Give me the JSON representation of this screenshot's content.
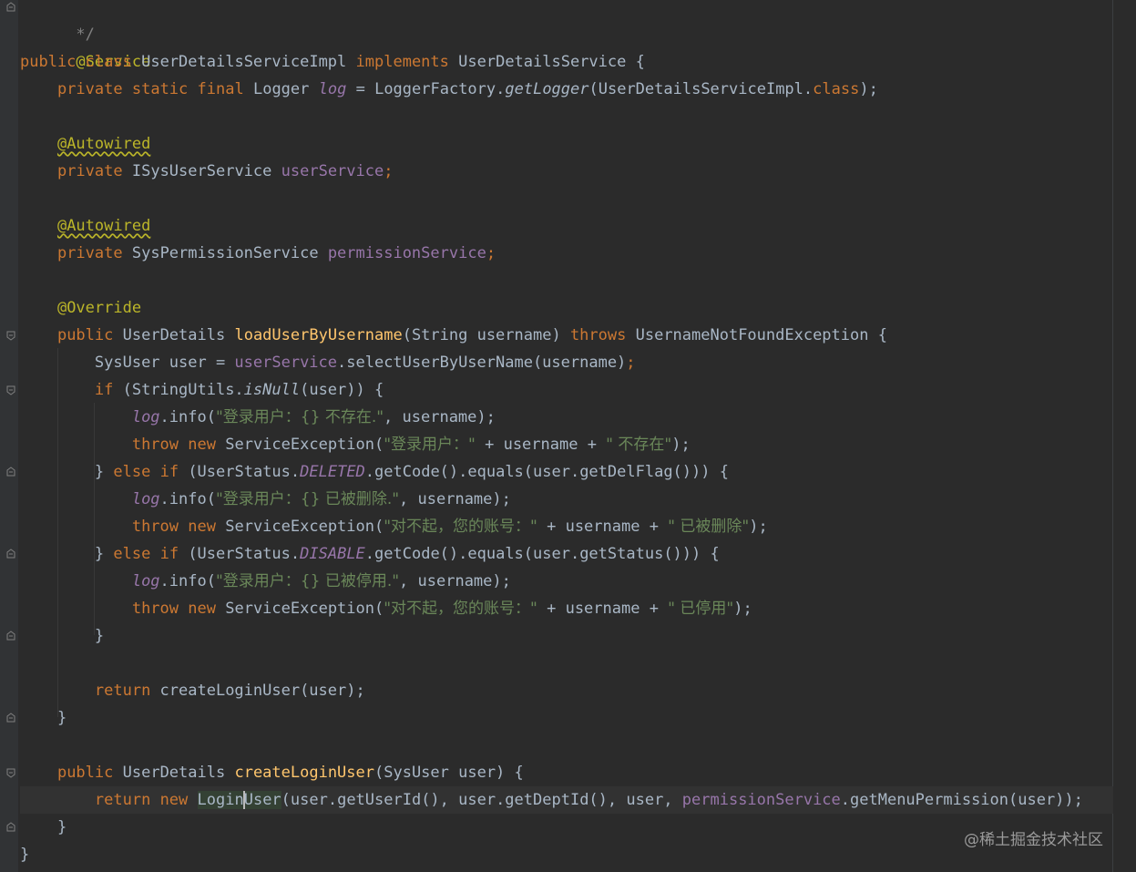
{
  "editor": {
    "language": "java",
    "cursor_line": 29,
    "watermark": "@稀土掘金技术社区"
  },
  "code": {
    "comment_end": "*/",
    "service_ann": "@Service",
    "kw_public": "public",
    "kw_class": "class",
    "class_name": "UserDetailsServiceImpl",
    "kw_implements": "implements",
    "iface_name": "UserDetailsService",
    "brace_open": "{",
    "brace_close": "}",
    "kw_private": "private",
    "kw_static": "static",
    "kw_final": "final",
    "type_logger": "Logger",
    "fld_log": "log",
    "assign": " = ",
    "logger_factory": "LoggerFactory.",
    "get_logger": "getLogger",
    "class_ref": "(UserDetailsServiceImpl.",
    "class_kw": "class",
    "close_paren_semi": ");",
    "autowired": "@Autowired",
    "type_isysuserservice": "ISysUserService",
    "fld_user_service": "userService",
    "semi": ";",
    "type_syspermissionservice": "SysPermissionService",
    "fld_permission_service": "permissionService",
    "override": "@Override",
    "type_userdetails": "UserDetails",
    "method_load": "loadUserByUsername",
    "param_load": "(String username) ",
    "kw_throws": "throws",
    "exc_type": "UsernameNotFoundException",
    "sysuser_decl": "SysUser user = ",
    "select_call": ".selectUserByUserName(username)",
    "kw_if": "if",
    "string_utils": " (StringUtils.",
    "is_null": "isNull",
    "is_null_args": "(user)) {",
    "info_call": ".info(",
    "str_not_exist": "\"登录用户：{} 不存在.\"",
    "comma_username": ", username);",
    "kw_throw": "throw",
    "kw_new": "new",
    "service_exception": "ServiceException(",
    "str_login_user": "\"登录用户：\"",
    "plus_username_plus": " + username + ",
    "str_not_exist2": "\" 不存在\"",
    "kw_else": "else",
    "user_status_open": " (UserStatus.",
    "deleted": "DELETED",
    "del_flag_expr": ".getCode().equals(user.getDelFlag())) {",
    "str_deleted": "\"登录用户：{} 已被删除.\"",
    "str_sorry": "\"对不起，您的账号：\"",
    "str_deleted2": "\" 已被删除\"",
    "disable": "DISABLE",
    "status_expr": ".getCode().equals(user.getStatus())) {",
    "str_disabled": "\"登录用户：{} 已被停用.\"",
    "str_disabled2": "\" 已停用\"",
    "kw_return": "return",
    "create_call": " createLoginUser(user);",
    "method_create": "createLoginUser",
    "param_create": "(SysUser user) {",
    "login_pre": "Login",
    "login_post": "User",
    "login_args": "(user.getUserId(), user.getDeptId(), user, ",
    "get_menu_perm": ".getMenuPermission(user));"
  }
}
